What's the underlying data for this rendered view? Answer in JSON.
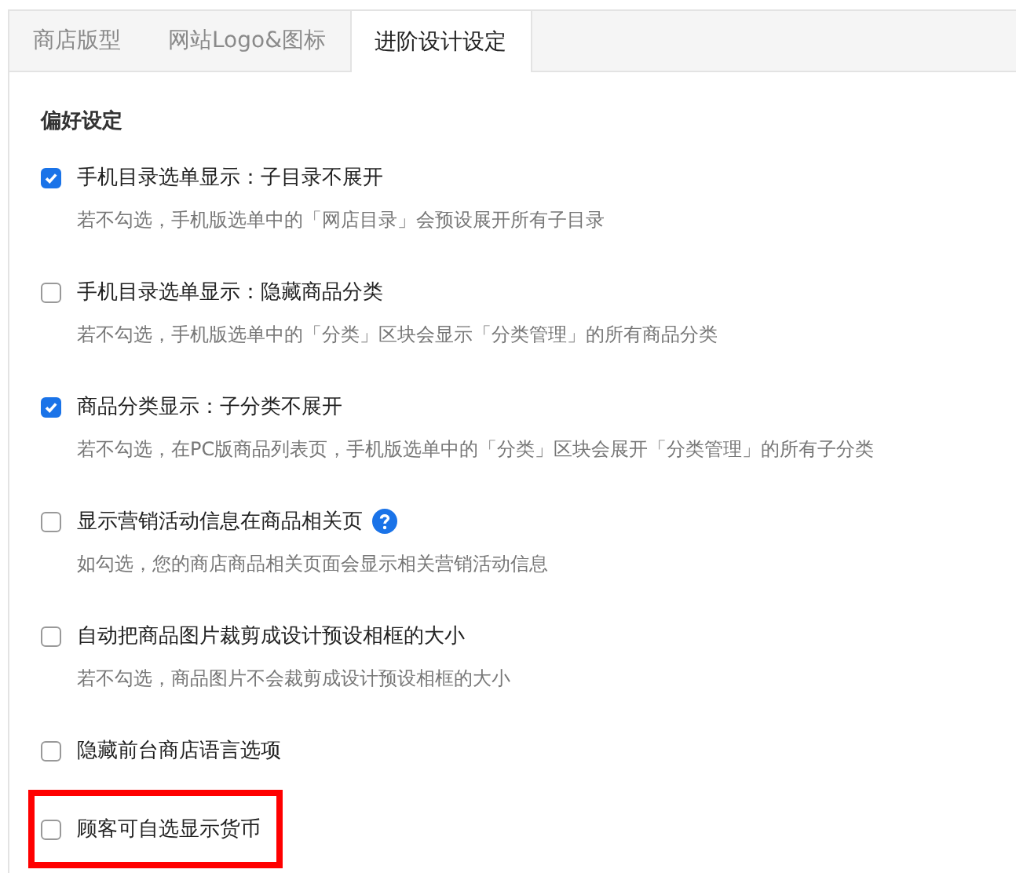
{
  "tabs": [
    {
      "label": "商店版型",
      "selected": false
    },
    {
      "label": "网站Logo&图标",
      "selected": false
    },
    {
      "label": "进阶设计设定",
      "selected": true
    }
  ],
  "section_title": "偏好设定",
  "options": [
    {
      "label": "手机目录选单显示：子目录不展开",
      "checked": true,
      "description": "若不勾选，手机版选单中的「网店目录」会预设展开所有子目录",
      "help": false,
      "highlighted": false
    },
    {
      "label": "手机目录选单显示：隐藏商品分类",
      "checked": false,
      "description": "若不勾选，手机版选单中的「分类」区块会显示「分类管理」的所有商品分类",
      "help": false,
      "highlighted": false
    },
    {
      "label": "商品分类显示：子分类不展开",
      "checked": true,
      "description": "若不勾选，在PC版商品列表页，手机版选单中的「分类」区块会展开「分类管理」的所有子分类",
      "help": false,
      "highlighted": false
    },
    {
      "label": "显示营销活动信息在商品相关页",
      "checked": false,
      "description": "如勾选，您的商店商品相关页面会显示相关营销活动信息",
      "help": true,
      "highlighted": false
    },
    {
      "label": "自动把商品图片裁剪成设计预设相框的大小",
      "checked": false,
      "description": "若不勾选，商品图片不会裁剪成设计预设相框的大小",
      "help": false,
      "highlighted": false
    },
    {
      "label": "隐藏前台商店语言选项",
      "checked": false,
      "highlighted": false
    },
    {
      "label": "顾客可自选显示货币",
      "checked": false,
      "highlighted": true
    }
  ]
}
